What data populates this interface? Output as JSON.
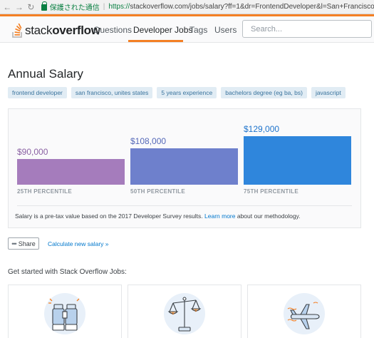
{
  "browser": {
    "secure_label": "保護された通信",
    "url_protocol": "https://",
    "url_rest": "stackoverflow.com/jobs/salary?ff=1&dr=FrontendDeveloper&l=San+Francisco%2C+Uni"
  },
  "header": {
    "logo_light": "stack",
    "logo_bold": "overflow",
    "nav": [
      "Questions",
      "Developer Jobs",
      "Tags",
      "Users"
    ],
    "active_nav": "Developer Jobs",
    "search_placeholder": "Search...",
    "accent_color": "#f48024"
  },
  "main": {
    "title": "Annual Salary",
    "tags": [
      "frontend developer",
      "san francisco, unites states",
      "5 years experience",
      "bachelors degree (eg ba, bs)",
      "javascript"
    ]
  },
  "salary": {
    "bars": [
      {
        "value": "$90,000",
        "amount": 90000,
        "percentile": "25TH PERCENTILE",
        "color": "#a57cbc",
        "text_color": "#8a61a3"
      },
      {
        "value": "$108,000",
        "amount": 108000,
        "percentile": "50TH PERCENTILE",
        "color": "#6e80cc",
        "text_color": "#5468b8"
      },
      {
        "value": "$129,000",
        "amount": 129000,
        "percentile": "75TH PERCENTILE",
        "color": "#2f86dc",
        "text_color": "#1f74cc"
      }
    ],
    "note_before": "Salary is a pre-tax value based on the 2017 Developer Survey results. ",
    "note_link": "Learn more",
    "note_after": " about our methodology."
  },
  "actions": {
    "share_label": "Share",
    "calculate_label": "Calculate new salary »"
  },
  "get_started": {
    "heading": "Get started with Stack Overflow Jobs:",
    "cards": [
      {
        "icon": "binoculars-icon"
      },
      {
        "icon": "balance-scale-icon"
      },
      {
        "icon": "airplane-icon"
      }
    ]
  }
}
